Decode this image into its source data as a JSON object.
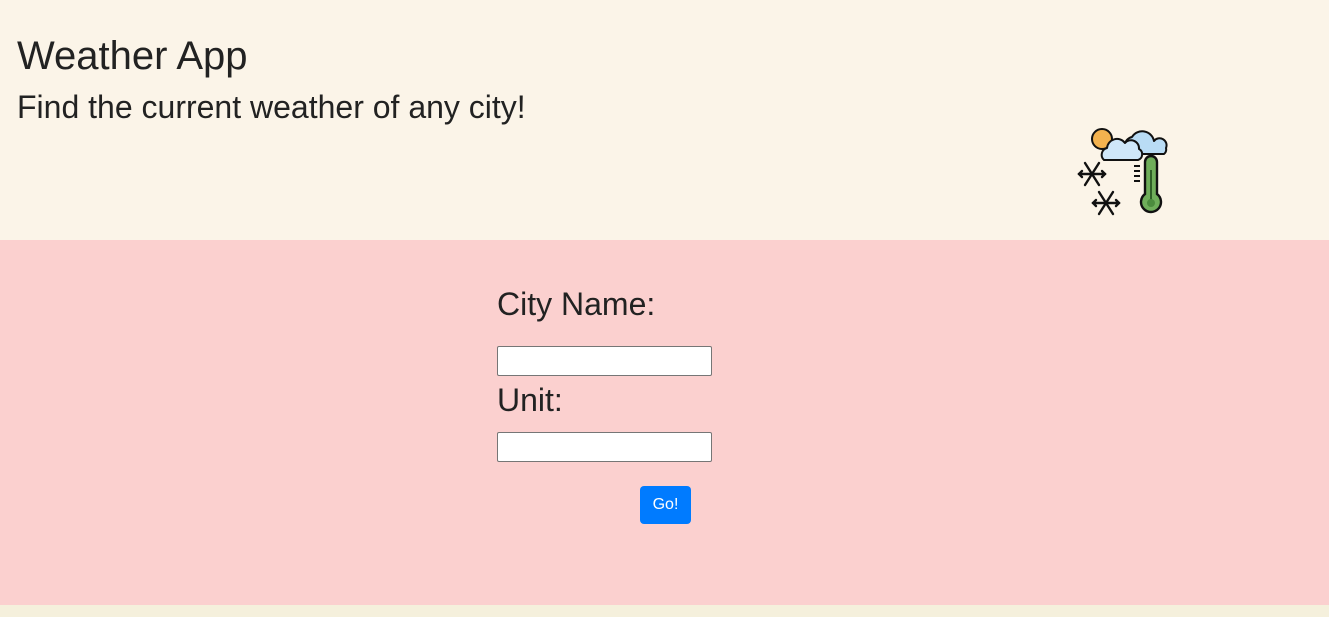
{
  "header": {
    "title": "Weather App",
    "subtitle": "Find the current weather of any city!",
    "icon": "weather-cold-thermometer-icon"
  },
  "form": {
    "city_label": "City Name:",
    "city_value": "",
    "unit_label": "Unit:",
    "unit_value": "",
    "submit_label": "Go!"
  },
  "colors": {
    "header_bg": "#fbf4e8",
    "main_bg": "#fbd0cf",
    "button_bg": "#007bff",
    "footer_bg": "#f5f0dc"
  }
}
